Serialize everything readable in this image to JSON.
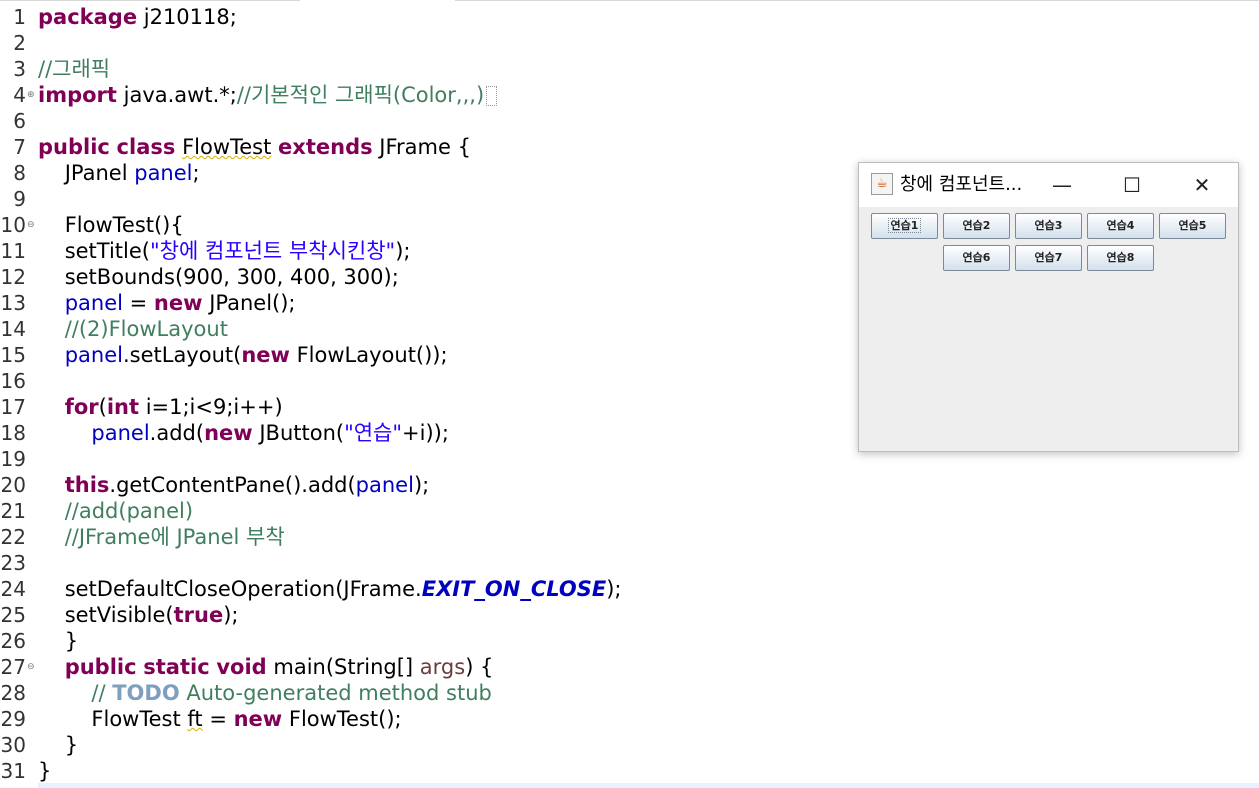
{
  "editor": {
    "lines": {
      "l1": {
        "num": "1",
        "a": "package",
        "b": " j210118;"
      },
      "l2": {
        "num": "2"
      },
      "l3": {
        "num": "3",
        "c": "//그래픽"
      },
      "l4": {
        "num": "4",
        "a": "import",
        "b": " java.awt.*;",
        "c": "//기본적인 그래픽(Color,,,)"
      },
      "l5": {
        "num": "6"
      },
      "l7": {
        "num": "7",
        "a": "public",
        "b": " ",
        "c": "class",
        "d": " ",
        "e": "FlowTest",
        "f": " ",
        "g": "extends",
        "h": " JFrame {"
      },
      "l8": {
        "num": "8",
        "a": "    JPanel ",
        "b": "panel",
        "c": ";"
      },
      "l9": {
        "num": "9"
      },
      "l10": {
        "num": "10",
        "a": "    FlowTest(){"
      },
      "l11": {
        "num": "11",
        "a": "    setTitle(",
        "b": "\"창에 컴포넌트 부착시킨창\"",
        "c": ");"
      },
      "l12": {
        "num": "12",
        "a": "    setBounds(900, 300, 400, 300);"
      },
      "l13": {
        "num": "13",
        "a": "    ",
        "b": "panel",
        "c": " = ",
        "d": "new",
        "e": " JPanel();"
      },
      "l14": {
        "num": "14",
        "a": "    ",
        "b": "//(2)FlowLayout"
      },
      "l15": {
        "num": "15",
        "a": "    ",
        "b": "panel",
        "c": ".setLayout(",
        "d": "new",
        "e": " FlowLayout());"
      },
      "l16": {
        "num": "16"
      },
      "l17": {
        "num": "17",
        "a": "    ",
        "b": "for",
        "c": "(",
        "d": "int",
        "e": " i=1;i<9;i++)"
      },
      "l18": {
        "num": "18",
        "a": "        ",
        "b": "panel",
        "c": ".add(",
        "d": "new",
        "e": " JButton(",
        "f": "\"연습\"",
        "g": "+i));"
      },
      "l19": {
        "num": "19"
      },
      "l20": {
        "num": "20",
        "a": "    ",
        "b": "this",
        "c": ".getContentPane().add(",
        "d": "panel",
        "e": ");"
      },
      "l21": {
        "num": "21",
        "a": "    ",
        "b": "//add(panel)"
      },
      "l22": {
        "num": "22",
        "a": "    ",
        "b": "//JFrame에 JPanel 부착"
      },
      "l23": {
        "num": "23"
      },
      "l24": {
        "num": "24",
        "a": "    setDefaultCloseOperation(JFrame.",
        "b": "EXIT_ON_CLOSE",
        "c": ");"
      },
      "l25": {
        "num": "25",
        "a": "    setVisible(",
        "b": "true",
        "c": ");"
      },
      "l26": {
        "num": "26",
        "a": "    }"
      },
      "l27": {
        "num": "27",
        "a": "    ",
        "b": "public",
        "c": " ",
        "d": "static",
        "e": " ",
        "f": "void",
        "g": " main(String[] ",
        "h": "args",
        "i": ") {"
      },
      "l28": {
        "num": "28",
        "a": "        ",
        "b": "// ",
        "c": "TODO",
        "d": " Auto-generated method stub"
      },
      "l29": {
        "num": "29",
        "a": "        FlowTest ",
        "b": "ft",
        "c": " = ",
        "d": "new",
        "e": " FlowTest();"
      },
      "l30": {
        "num": "30",
        "a": "    }"
      },
      "l31": {
        "num": "31",
        "a": "}"
      }
    }
  },
  "window": {
    "title": "창에 컴포넌트...",
    "icon": "java-cup-icon",
    "minimize": "—",
    "maximize": "☐",
    "close": "✕",
    "buttons": [
      "연습1",
      "연습2",
      "연습3",
      "연습4",
      "연습5",
      "연습6",
      "연습7",
      "연습8"
    ]
  }
}
